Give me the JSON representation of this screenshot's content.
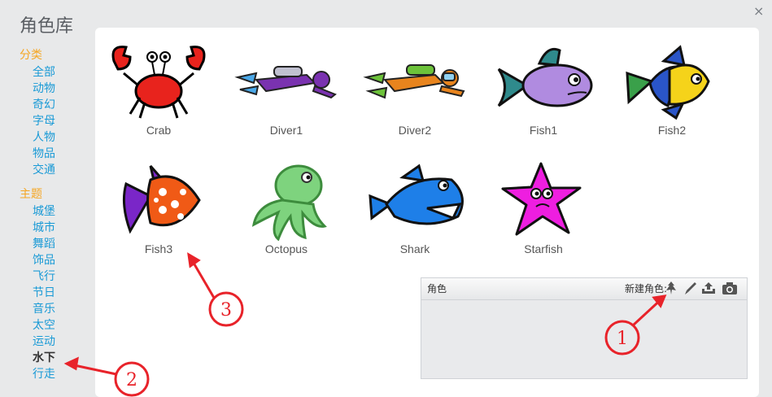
{
  "window": {
    "title": "角色库",
    "close_glyph": "×"
  },
  "sidebar": {
    "category_header": "分类",
    "categories": [
      "全部",
      "动物",
      "奇幻",
      "字母",
      "人物",
      "物品",
      "交通"
    ],
    "theme_header": "主题",
    "themes": [
      "城堡",
      "城市",
      "舞蹈",
      "饰品",
      "飞行",
      "节日",
      "音乐",
      "太空",
      "运动",
      "水下",
      "行走"
    ],
    "active_theme": "水下"
  },
  "sprites": [
    {
      "name": "Crab"
    },
    {
      "name": "Diver1"
    },
    {
      "name": "Diver2"
    },
    {
      "name": "Fish1"
    },
    {
      "name": "Fish2"
    },
    {
      "name": "Fish3"
    },
    {
      "name": "Octopus"
    },
    {
      "name": "Shark"
    },
    {
      "name": "Starfish"
    }
  ],
  "sprite_panel": {
    "title": "角色",
    "new_sprite_label": "新建角色:",
    "tools": [
      "sprite-library-icon",
      "paint-brush-icon",
      "upload-icon",
      "camera-icon"
    ]
  },
  "annotations": [
    "1",
    "2",
    "3"
  ],
  "colors": {
    "accent_orange": "#f5a623",
    "link_blue": "#1a9ad6",
    "annotation_red": "#e8232a"
  }
}
